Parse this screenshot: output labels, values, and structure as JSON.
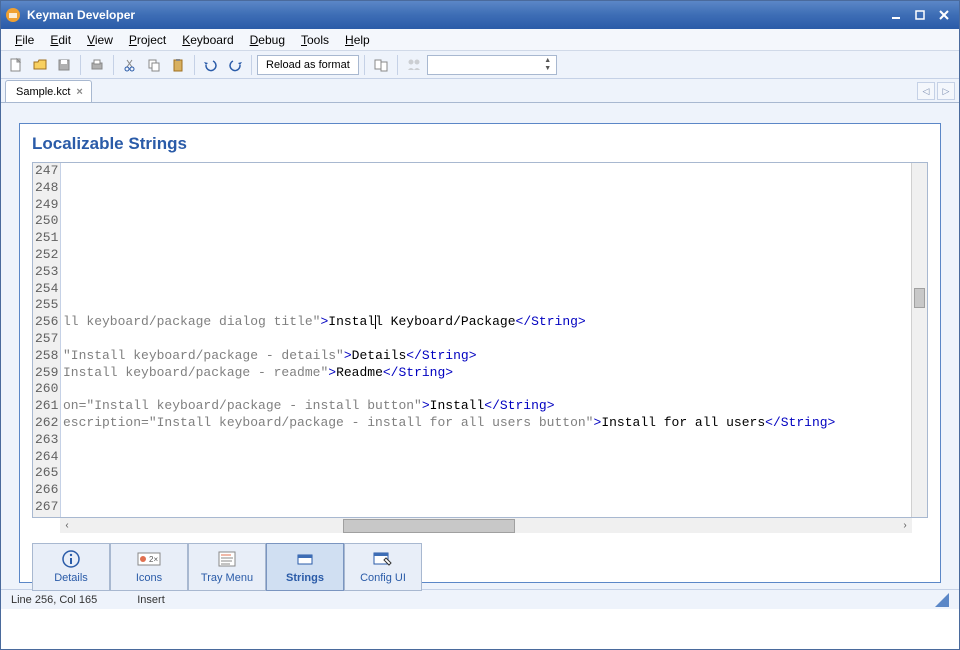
{
  "window": {
    "title": "Keyman Developer"
  },
  "menu": {
    "items": [
      {
        "label": "File",
        "u": 0
      },
      {
        "label": "Edit",
        "u": 0
      },
      {
        "label": "View",
        "u": 0
      },
      {
        "label": "Project",
        "u": 0
      },
      {
        "label": "Keyboard",
        "u": 0
      },
      {
        "label": "Debug",
        "u": 0
      },
      {
        "label": "Tools",
        "u": 0
      },
      {
        "label": "Help",
        "u": 0
      }
    ]
  },
  "toolbar": {
    "reload_label": "Reload as format"
  },
  "file_tab": {
    "name": "Sample.kct"
  },
  "panel": {
    "title": "Localizable Strings"
  },
  "editor": {
    "first_line": 247,
    "line_count": 21,
    "lines": [
      {
        "n": 247,
        "c": []
      },
      {
        "n": 248,
        "c": []
      },
      {
        "n": 249,
        "c": []
      },
      {
        "n": 250,
        "c": []
      },
      {
        "n": 251,
        "c": []
      },
      {
        "n": 252,
        "c": []
      },
      {
        "n": 253,
        "c": []
      },
      {
        "n": 254,
        "c": []
      },
      {
        "n": 255,
        "c": []
      },
      {
        "n": 256,
        "c": [
          {
            "t": "attr",
            "v": "ll keyboard/package dialog title\""
          },
          {
            "t": "tag",
            "v": ">"
          },
          {
            "t": "text",
            "v": "Instal"
          },
          {
            "t": "caret"
          },
          {
            "t": "text",
            "v": "l Keyboard/Package"
          },
          {
            "t": "tag",
            "v": "</String>"
          }
        ]
      },
      {
        "n": 257,
        "c": []
      },
      {
        "n": 258,
        "c": [
          {
            "t": "attr",
            "v": "\"Install keyboard/package - details\""
          },
          {
            "t": "tag",
            "v": ">"
          },
          {
            "t": "text",
            "v": "Details"
          },
          {
            "t": "tag",
            "v": "</String>"
          }
        ]
      },
      {
        "n": 259,
        "c": [
          {
            "t": "attr",
            "v": "Install keyboard/package - readme\""
          },
          {
            "t": "tag",
            "v": ">"
          },
          {
            "t": "text",
            "v": "Readme"
          },
          {
            "t": "tag",
            "v": "</String>"
          }
        ]
      },
      {
        "n": 260,
        "c": []
      },
      {
        "n": 261,
        "c": [
          {
            "t": "attr",
            "v": "on=\"Install keyboard/package - install button\""
          },
          {
            "t": "tag",
            "v": ">"
          },
          {
            "t": "text",
            "v": "Install"
          },
          {
            "t": "tag",
            "v": "</String>"
          }
        ]
      },
      {
        "n": 262,
        "c": [
          {
            "t": "attr",
            "v": "escription=\"Install keyboard/package - install for all users button\""
          },
          {
            "t": "tag",
            "v": ">"
          },
          {
            "t": "text",
            "v": "Install for all users"
          },
          {
            "t": "tag",
            "v": "</String>"
          }
        ]
      },
      {
        "n": 263,
        "c": []
      },
      {
        "n": 264,
        "c": []
      },
      {
        "n": 265,
        "c": []
      },
      {
        "n": 266,
        "c": []
      },
      {
        "n": 267,
        "c": []
      }
    ]
  },
  "bottom_tabs": [
    {
      "id": "details",
      "label": "Details",
      "active": false
    },
    {
      "id": "icons",
      "label": "Icons",
      "active": false
    },
    {
      "id": "traymenu",
      "label": "Tray Menu",
      "active": false
    },
    {
      "id": "strings",
      "label": "Strings",
      "active": true
    },
    {
      "id": "configui",
      "label": "Config UI",
      "active": false
    }
  ],
  "status": {
    "pos": "Line 256, Col 165",
    "mode": "Insert"
  }
}
